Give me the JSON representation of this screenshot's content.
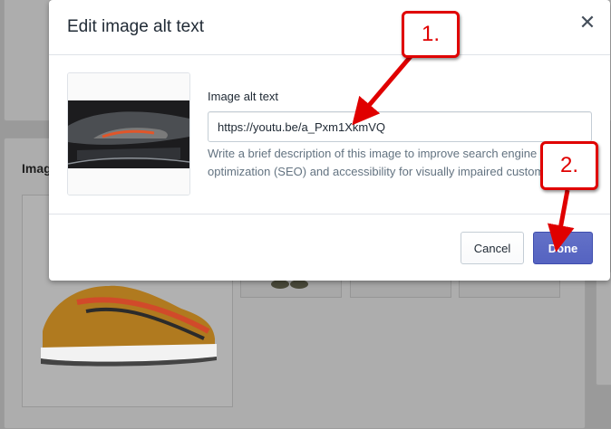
{
  "background": {
    "section_title": "Imag"
  },
  "modal": {
    "title": "Edit image alt text",
    "close_icon": "close-icon",
    "field_label": "Image alt text",
    "field_value": "https://youtu.be/a_Pxm1XkmVQ",
    "help_text": "Write a brief description of this image to improve search engine optimization (SEO) and accessibility for visually impaired customers.",
    "cancel_label": "Cancel",
    "done_label": "Done"
  },
  "annotations": {
    "step1": "1.",
    "step2": "2."
  },
  "colors": {
    "primary": "#5c6ac4",
    "annotation": "#e00000"
  }
}
